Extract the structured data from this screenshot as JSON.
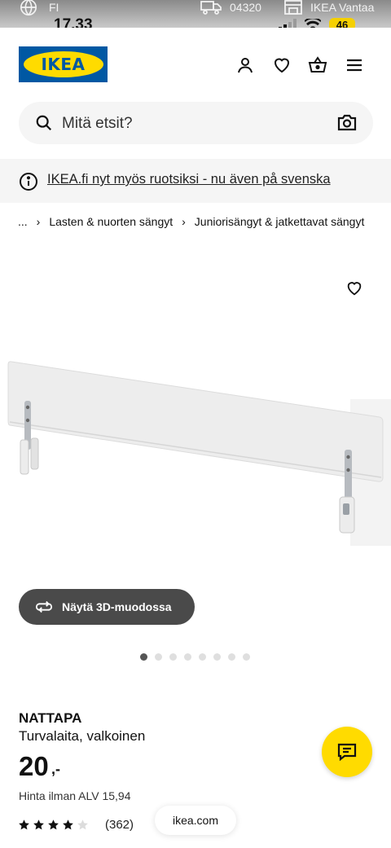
{
  "status_bar": {
    "language": "FI",
    "time": "17.33",
    "postal_code": "04320",
    "store": "IKEA Vantaa",
    "battery": "46"
  },
  "header": {
    "logo_text": "IKEA",
    "icons": [
      "user-icon",
      "heart-icon",
      "basket-icon",
      "menu-icon"
    ]
  },
  "search": {
    "placeholder": "Mitä etsit?"
  },
  "banner": {
    "text": "IKEA.fi nyt myös ruotsiksi - nu även på svenska"
  },
  "breadcrumb": {
    "items": [
      "...",
      "Lasten & nuorten sängyt",
      "Juniorisängyt & jatkettavat sängyt"
    ],
    "separator": "›"
  },
  "gallery": {
    "button_3d": "Näytä 3D-muodossa",
    "total_images": 8,
    "active_index": 0
  },
  "product": {
    "name": "NATTAPA",
    "description": "Turvalaita, valkoinen",
    "price": "20",
    "price_suffix": ",-",
    "vat_text": "Hinta ilman ALV 15,94",
    "rating": 4,
    "rating_max": 5,
    "reviews": "(362)"
  },
  "browser": {
    "url": "ikea.com"
  },
  "colors": {
    "ikea_blue": "#0058a3",
    "ikea_yellow": "#ffdb00"
  }
}
